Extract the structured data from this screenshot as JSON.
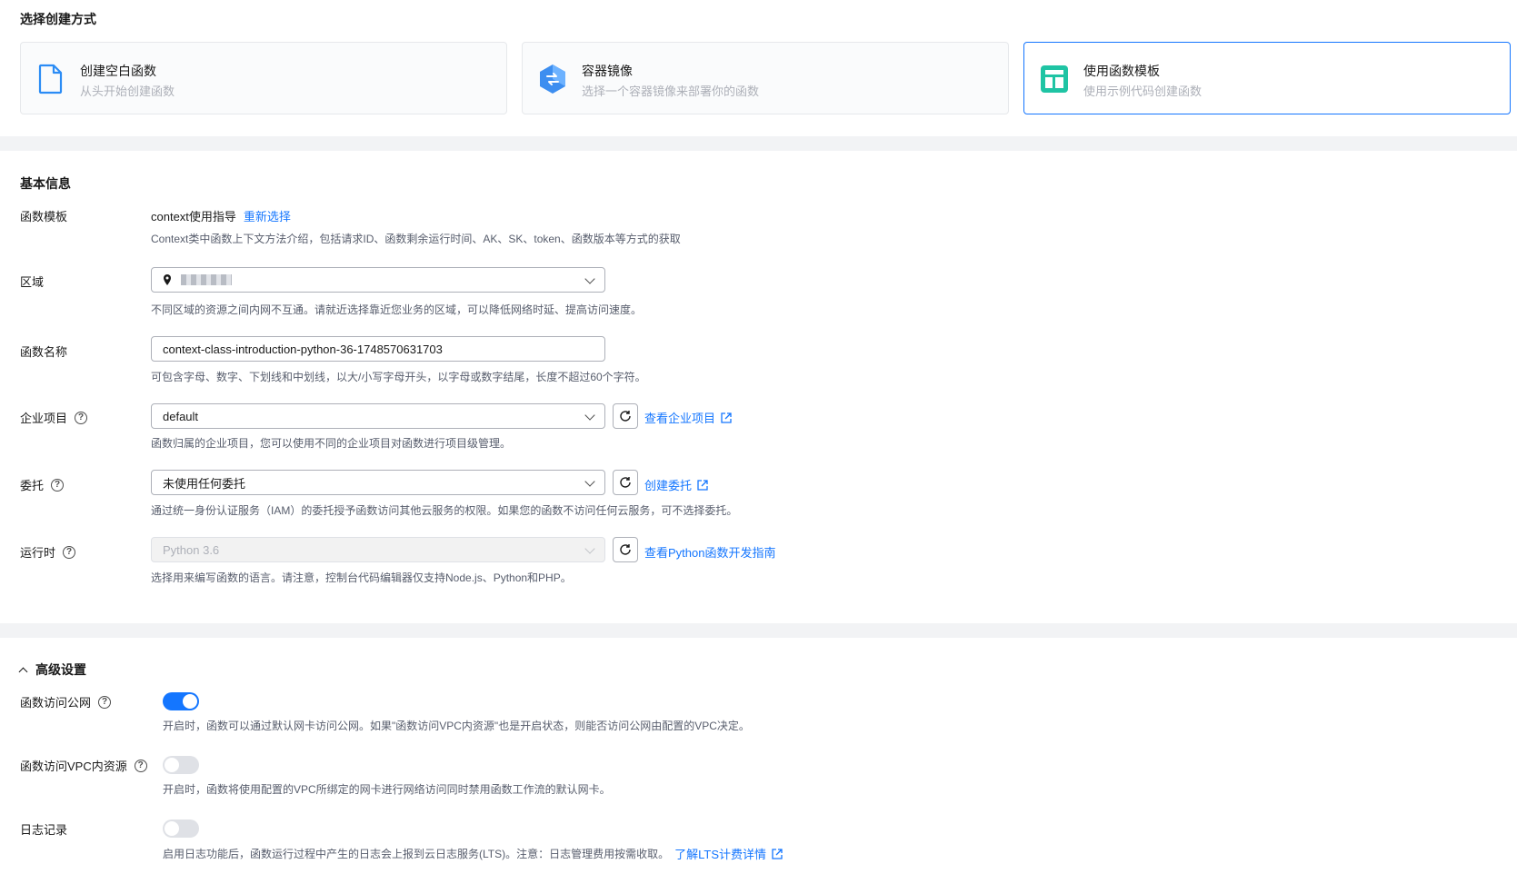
{
  "creation": {
    "title": "选择创建方式",
    "cards": [
      {
        "title": "创建空白函数",
        "desc": "从头开始创建函数",
        "icon": "blank-file-icon"
      },
      {
        "title": "容器镜像",
        "desc": "选择一个容器镜像来部署你的函数",
        "icon": "container-image-icon"
      },
      {
        "title": "使用函数模板",
        "desc": "使用示例代码创建函数",
        "icon": "template-icon",
        "selected": true
      }
    ]
  },
  "basic": {
    "title": "基本信息",
    "template": {
      "label": "函数模板",
      "value": "context使用指导",
      "reselect": "重新选择",
      "hint": "Context类中函数上下文方法介绍，包括请求ID、函数剩余运行时间、AK、SK、token、函数版本等方式的获取"
    },
    "region": {
      "label": "区域",
      "hint": "不同区域的资源之间内网不互通。请就近选择靠近您业务的区域，可以降低网络时延、提高访问速度。"
    },
    "name": {
      "label": "函数名称",
      "value": "context-class-introduction-python-36-1748570631703",
      "hint": "可包含字母、数字、下划线和中划线，以大/小写字母开头，以字母或数字结尾，长度不超过60个字符。"
    },
    "project": {
      "label": "企业项目",
      "value": "default",
      "link": "查看企业项目",
      "hint": "函数归属的企业项目，您可以使用不同的企业项目对函数进行项目级管理。"
    },
    "agency": {
      "label": "委托",
      "value": "未使用任何委托",
      "link": "创建委托",
      "hint": "通过统一身份认证服务（IAM）的委托授予函数访问其他云服务的权限。如果您的函数不访问任何云服务，可不选择委托。"
    },
    "runtime": {
      "label": "运行时",
      "value": "Python 3.6",
      "link": "查看Python函数开发指南",
      "hint": "选择用来编写函数的语言。请注意，控制台代码编辑器仅支持Node.js、Python和PHP。"
    }
  },
  "advanced": {
    "title": "高级设置",
    "public": {
      "label": "函数访问公网",
      "enabled": true,
      "hint": "开启时，函数可以通过默认网卡访问公网。如果\"函数访问VPC内资源\"也是开启状态，则能否访问公网由配置的VPC决定。"
    },
    "vpc": {
      "label": "函数访问VPC内资源",
      "enabled": false,
      "hint": "开启时，函数将使用配置的VPC所绑定的网卡进行网络访问同时禁用函数工作流的默认网卡。"
    },
    "log": {
      "label": "日志记录",
      "enabled": false,
      "hint": "启用日志功能后，函数运行过程中产生的日志会上报到云日志服务(LTS)。注意：日志管理费用按需收取。",
      "link": "了解LTS计费详情"
    }
  },
  "colors": {
    "accent": "#1476ff",
    "hint": "#575d6c",
    "toggle_off": "#dfe1e6"
  }
}
